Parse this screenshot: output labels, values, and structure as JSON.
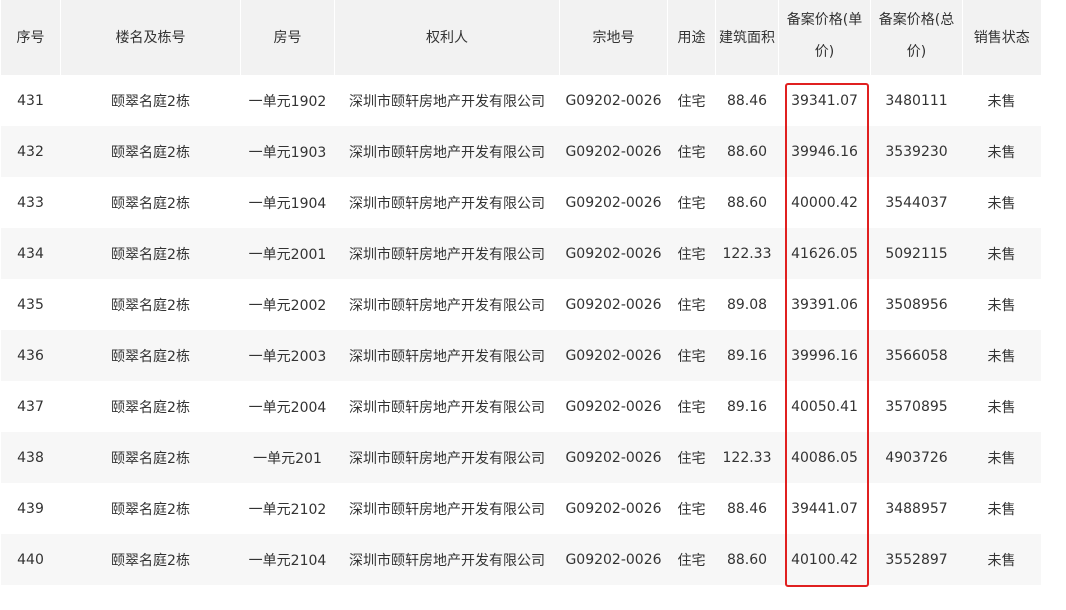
{
  "columns": [
    {
      "key": "seq",
      "label": "序号"
    },
    {
      "key": "building",
      "label": "楼名及栋号"
    },
    {
      "key": "room",
      "label": "房号"
    },
    {
      "key": "owner",
      "label": "权利人"
    },
    {
      "key": "parcel",
      "label": "宗地号"
    },
    {
      "key": "usage",
      "label": "用途"
    },
    {
      "key": "area",
      "label": "建筑面积"
    },
    {
      "key": "unit_price",
      "label_line1": "备案价格(单",
      "label_line2": "价)"
    },
    {
      "key": "total_price",
      "label_line1": "备案价格(总",
      "label_line2": "价)"
    },
    {
      "key": "status",
      "label": "销售状态"
    }
  ],
  "rows": [
    {
      "seq": "431",
      "building": "颐翠名庭2栋",
      "room": "一单元1902",
      "owner": "深圳市颐轩房地产开发有限公司",
      "parcel": "G09202-0026",
      "usage": "住宅",
      "area": "88.46",
      "unit_price": "39341.07",
      "total_price": "3480111",
      "status": "未售"
    },
    {
      "seq": "432",
      "building": "颐翠名庭2栋",
      "room": "一单元1903",
      "owner": "深圳市颐轩房地产开发有限公司",
      "parcel": "G09202-0026",
      "usage": "住宅",
      "area": "88.60",
      "unit_price": "39946.16",
      "total_price": "3539230",
      "status": "未售"
    },
    {
      "seq": "433",
      "building": "颐翠名庭2栋",
      "room": "一单元1904",
      "owner": "深圳市颐轩房地产开发有限公司",
      "parcel": "G09202-0026",
      "usage": "住宅",
      "area": "88.60",
      "unit_price": "40000.42",
      "total_price": "3544037",
      "status": "未售"
    },
    {
      "seq": "434",
      "building": "颐翠名庭2栋",
      "room": "一单元2001",
      "owner": "深圳市颐轩房地产开发有限公司",
      "parcel": "G09202-0026",
      "usage": "住宅",
      "area": "122.33",
      "unit_price": "41626.05",
      "total_price": "5092115",
      "status": "未售"
    },
    {
      "seq": "435",
      "building": "颐翠名庭2栋",
      "room": "一单元2002",
      "owner": "深圳市颐轩房地产开发有限公司",
      "parcel": "G09202-0026",
      "usage": "住宅",
      "area": "89.08",
      "unit_price": "39391.06",
      "total_price": "3508956",
      "status": "未售"
    },
    {
      "seq": "436",
      "building": "颐翠名庭2栋",
      "room": "一单元2003",
      "owner": "深圳市颐轩房地产开发有限公司",
      "parcel": "G09202-0026",
      "usage": "住宅",
      "area": "89.16",
      "unit_price": "39996.16",
      "total_price": "3566058",
      "status": "未售"
    },
    {
      "seq": "437",
      "building": "颐翠名庭2栋",
      "room": "一单元2004",
      "owner": "深圳市颐轩房地产开发有限公司",
      "parcel": "G09202-0026",
      "usage": "住宅",
      "area": "89.16",
      "unit_price": "40050.41",
      "total_price": "3570895",
      "status": "未售"
    },
    {
      "seq": "438",
      "building": "颐翠名庭2栋",
      "room": "一单元201",
      "owner": "深圳市颐轩房地产开发有限公司",
      "parcel": "G09202-0026",
      "usage": "住宅",
      "area": "122.33",
      "unit_price": "40086.05",
      "total_price": "4903726",
      "status": "未售"
    },
    {
      "seq": "439",
      "building": "颐翠名庭2栋",
      "room": "一单元2102",
      "owner": "深圳市颐轩房地产开发有限公司",
      "parcel": "G09202-0026",
      "usage": "住宅",
      "area": "88.46",
      "unit_price": "39441.07",
      "total_price": "3488957",
      "status": "未售"
    },
    {
      "seq": "440",
      "building": "颐翠名庭2栋",
      "room": "一单元2104",
      "owner": "深圳市颐轩房地产开发有限公司",
      "parcel": "G09202-0026",
      "usage": "住宅",
      "area": "88.60",
      "unit_price": "40100.42",
      "total_price": "3552897",
      "status": "未售"
    }
  ],
  "colors": {
    "header_bg": "#f2f2f2",
    "stripe_bg": "#f7f7f7",
    "highlight": "#e02020"
  }
}
